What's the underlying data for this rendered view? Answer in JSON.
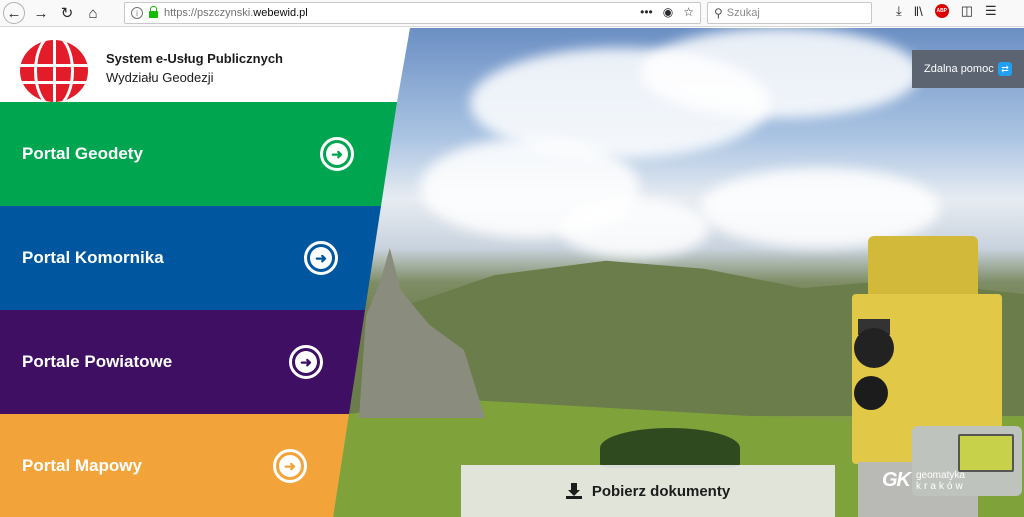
{
  "browser": {
    "url_prefix": "https://pszczynski.",
    "url_host": "webewid.pl",
    "search_placeholder": "Szukaj",
    "url_actions": "•••",
    "abp_label": "ABP"
  },
  "header": {
    "title": "System e-Usług Publicznych",
    "subtitle": "Wydziału Geodezji"
  },
  "portals": [
    {
      "label": "Portal Geodety",
      "color": "#00a54f"
    },
    {
      "label": "Portal Komornika",
      "color": "#0057a0"
    },
    {
      "label": "Portale Powiatowe",
      "color": "#3f0f63"
    },
    {
      "label": "Portal Mapowy",
      "color": "#f2a33a"
    }
  ],
  "remote_help": {
    "label": "Zdalna pomoc"
  },
  "documents": {
    "label": "Pobierz dokumenty"
  },
  "watermark": {
    "logo": "GK",
    "line1": "geomatyka",
    "line2": "kraków"
  }
}
